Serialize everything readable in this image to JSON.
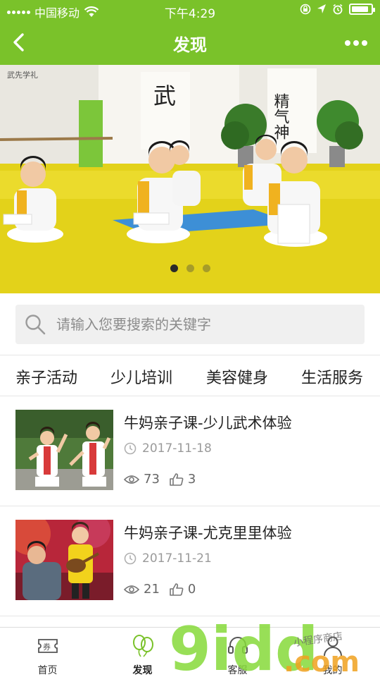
{
  "status_bar": {
    "carrier": "中国移动",
    "time": "下午4:29",
    "battery_level": 0.9
  },
  "nav": {
    "title": "发现"
  },
  "banner": {
    "calligraphy_left": "武",
    "calligraphy_right": "精气神",
    "calligraphy_wall": "武先学礼",
    "dot_count": 3,
    "active_index": 0
  },
  "search": {
    "placeholder": "请输入您要搜索的关键字",
    "value": ""
  },
  "categories": [
    {
      "label": "亲子活动"
    },
    {
      "label": "少儿培训"
    },
    {
      "label": "美容健身"
    },
    {
      "label": "生活服务"
    }
  ],
  "articles": [
    {
      "title": "牛妈亲子课-少儿武术体验",
      "date": "2017-11-18",
      "views": "73",
      "likes": "3"
    },
    {
      "title": "牛妈亲子课-尤克里里体验",
      "date": "2017-11-21",
      "views": "21",
      "likes": "0"
    }
  ],
  "tabs": [
    {
      "label": "首页",
      "icon": "coupon-icon",
      "ticket": "券"
    },
    {
      "label": "发现",
      "icon": "balloons-icon"
    },
    {
      "label": "客服",
      "icon": "headset-icon"
    },
    {
      "label": "我的",
      "icon": "user-icon"
    }
  ],
  "watermark": {
    "main": "9idd",
    "domain": ".com",
    "sub": "小程序商店"
  },
  "colors": {
    "brand_green": "#7ac22a",
    "text_dark": "#222222",
    "text_muted": "#9a9a9a"
  }
}
